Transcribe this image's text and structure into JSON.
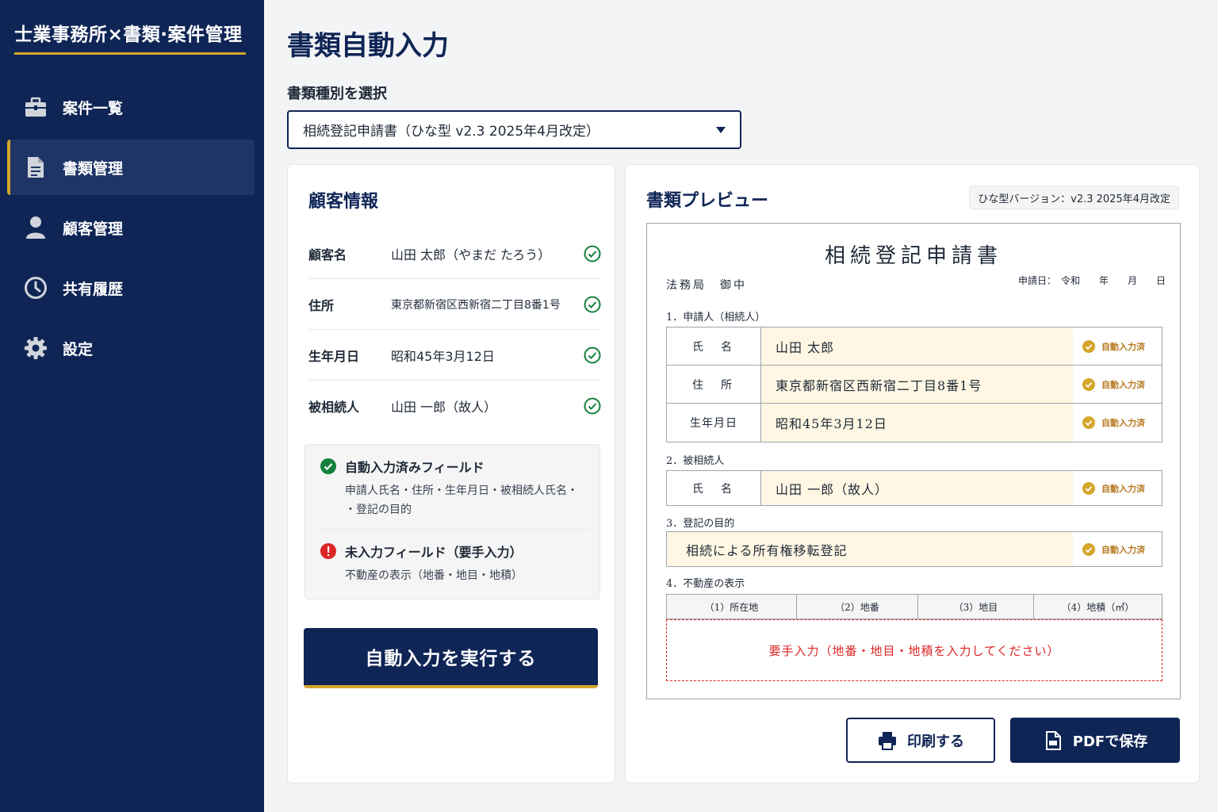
{
  "app": {
    "title": "士業事務所×書類·案件管理"
  },
  "sidebar": {
    "items": [
      {
        "label": "案件一覧",
        "icon": "briefcase-icon"
      },
      {
        "label": "書類管理",
        "icon": "document-icon",
        "active": true
      },
      {
        "label": "顧客管理",
        "icon": "person-icon"
      },
      {
        "label": "共有履歴",
        "icon": "clock-icon"
      },
      {
        "label": "設定",
        "icon": "gear-icon"
      }
    ]
  },
  "main": {
    "title": "書類自動入力",
    "select_label": "書類種別を選択",
    "select_value": "相続登記申請書（ひな型 v2.3 2025年4月改定）"
  },
  "customer": {
    "title": "顧客情報",
    "rows": [
      {
        "key": "顧客名",
        "value": "山田 太郎（やまだ たろう）"
      },
      {
        "key": "住所",
        "value": "東京都新宿区西新宿二丁目8番1号"
      },
      {
        "key": "生年月日",
        "value": "昭和45年3月12日"
      },
      {
        "key": "被相続人",
        "value": "山田 一郎（故人）"
      }
    ],
    "status": {
      "filled_title": "自動入力済みフィールド",
      "filled_line1": "申請人氏名・住所・生年月日・被相続人氏名・",
      "filled_line2": "・登記の目的",
      "missing_title": "未入力フィールド（要手入力）",
      "missing_desc": "不動産の表示（地番・地目・地積）"
    },
    "run_button": "自動入力を実行する"
  },
  "preview": {
    "title": "書類プレビュー",
    "version": "ひな型バージョン：v2.3 2025年4月改定",
    "doc": {
      "title": "相続登記申請書",
      "office": "法務局　御中",
      "date": "申請日：　令和　　年　　月　　日",
      "sec1": "1．申請人（相続人）",
      "sec1_rows": [
        {
          "key": "氏　名",
          "value": "山田 太郎",
          "status": "自動入力済"
        },
        {
          "key": "住　所",
          "value": "東京都新宿区西新宿二丁目8番1号",
          "status": "自動入力済"
        },
        {
          "key": "生年月日",
          "value": "昭和45年3月12日",
          "status": "自動入力済"
        }
      ],
      "sec2": "2．被相続人",
      "sec2_row": {
        "key": "氏　名",
        "value": "山田 一郎（故人）",
        "status": "自動入力済"
      },
      "sec3": "3．登記の目的",
      "sec3_row": {
        "value": "相続による所有権移転登記",
        "status": "自動入力済"
      },
      "sec4": "4．不動産の表示",
      "sec4_cols": [
        "（1）所在地",
        "（2）地番",
        "（3）地目",
        "（4）地積（㎡）"
      ],
      "sec4_empty": "要手入力（地番・地目・地積を入力してください）"
    },
    "print_button": "印刷する",
    "pdf_button": "PDFで保存"
  },
  "colors": {
    "navy": "#0f2556",
    "gold": "#d4a72c",
    "green": "#15803d",
    "red": "#dc2626",
    "fill": "#fff7e3"
  }
}
